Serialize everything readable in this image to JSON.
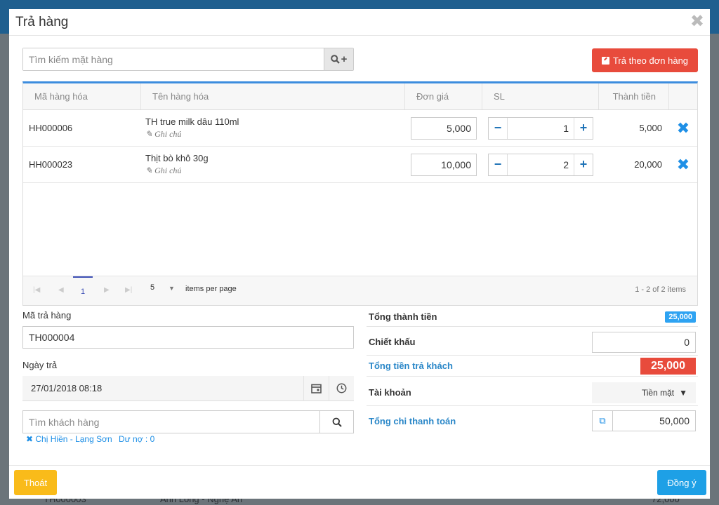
{
  "modal": {
    "title": "Trả hàng",
    "close_glyph": "✖"
  },
  "search": {
    "placeholder": "Tìm kiếm mặt hàng",
    "icon": "search-plus-icon"
  },
  "order_return_button": {
    "label": "Trả theo đơn hàng",
    "color": "#e84b3c"
  },
  "grid": {
    "columns": [
      "Mã hàng hóa",
      "Tên hàng hóa",
      "Đơn giá",
      "SL",
      "Thành tiền"
    ],
    "rows": [
      {
        "code": "HH000006",
        "name": "TH true milk dâu 110ml",
        "note": "Ghi chú",
        "price": "5,000",
        "qty": "1",
        "total": "5,000"
      },
      {
        "code": "HH000023",
        "name": "Thịt bò khô 30g",
        "note": "Ghi chú",
        "price": "10,000",
        "qty": "2",
        "total": "20,000"
      }
    ],
    "accent": "#3c8dde"
  },
  "pager": {
    "current_page": "1",
    "page_size": "5",
    "per_page_label": "items per page",
    "info": "1 - 2 of 2 items"
  },
  "form": {
    "return_code_label": "Mã trả hàng",
    "return_code_value": "TH000004",
    "return_date_label": "Ngày trả",
    "return_date_value": "27/01/2018 08:18",
    "customer_placeholder": "Tìm khách hàng",
    "customer_tag": "Chị Hiền - Lạng Sơn",
    "customer_debt": "Dư nợ : 0"
  },
  "summary": {
    "total_label": "Tổng thành tiền",
    "total_value": "25,000",
    "discount_label": "Chiết khấu",
    "discount_value": "0",
    "refund_label": "Tổng tiền trả khách",
    "refund_value": "25,000",
    "account_label": "Tài khoản",
    "account_value": "Tiền mặt",
    "payment_label": "Tổng chi thanh toán",
    "payment_value": "50,000"
  },
  "footer": {
    "exit_label": "Thoát",
    "ok_label": "Đồng ý",
    "exit_color": "#f9bb1a",
    "ok_color": "#1ea0e6"
  },
  "background": {
    "row_code": "TH000003",
    "row_customer": "Anh Long - Nghệ An",
    "row_amount": "72,000"
  }
}
